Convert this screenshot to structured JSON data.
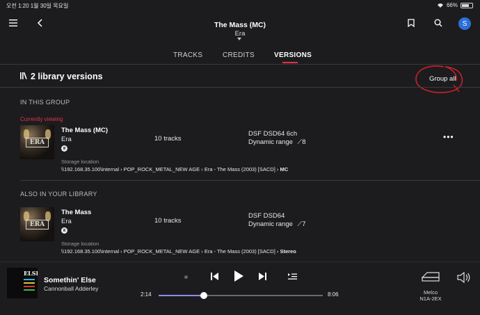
{
  "status": {
    "time_date": "오전 1:20   1월 30일 목요일",
    "battery": "66%"
  },
  "header": {
    "title": "The Mass (MC)",
    "subtitle": "Era",
    "avatar_letter": "S"
  },
  "tabs": [
    {
      "label": "TRACKS",
      "active": false
    },
    {
      "label": "CREDITS",
      "active": false
    },
    {
      "label": "VERSIONS",
      "active": true
    }
  ],
  "versions": {
    "heading": "2 library versions",
    "group_all_label": "Group all",
    "in_this_group_label": "IN THIS GROUP",
    "also_label": "ALSO IN YOUR LIBRARY",
    "current": {
      "badge": "Currently viewing",
      "title": "The Mass (MC)",
      "artist": "Era",
      "tracks": "10 tracks",
      "format": "DSF DSD64 6ch",
      "dynamic_range": "Dynamic range",
      "dr_value": "8",
      "storage_label": "Storage location",
      "path": [
        "\\\\192.168.35.100\\internal",
        "POP_ROCK_METAL_NEW AGE",
        "Era - The Mass (2003) [SACD]",
        "MC"
      ],
      "art_text": "ERA"
    },
    "other": {
      "title": "The Mass",
      "artist": "Era",
      "tracks": "10 tracks",
      "format": "DSF DSD64",
      "dynamic_range": "Dynamic range",
      "dr_value": "7",
      "storage_label": "Storage location",
      "path": [
        "\\\\192.168.35.100\\internal",
        "POP_ROCK_METAL_NEW AGE",
        "Era - The Mass (2003) [SACD]",
        "Stereo"
      ],
      "art_text": "ERA"
    }
  },
  "player": {
    "song": "Somethin' Else",
    "artist": "Cannonball Adderley",
    "cover_text": "ELSE",
    "elapsed": "2:14",
    "duration": "8:06",
    "progress": 0.276,
    "device_name": "Melco",
    "device_model": "N1A-2EX"
  },
  "colors": {
    "accent_red": "#e0344c",
    "progress": "#8d8cf0",
    "avatar": "#2c6fd6",
    "annotation": "#d0202a"
  }
}
